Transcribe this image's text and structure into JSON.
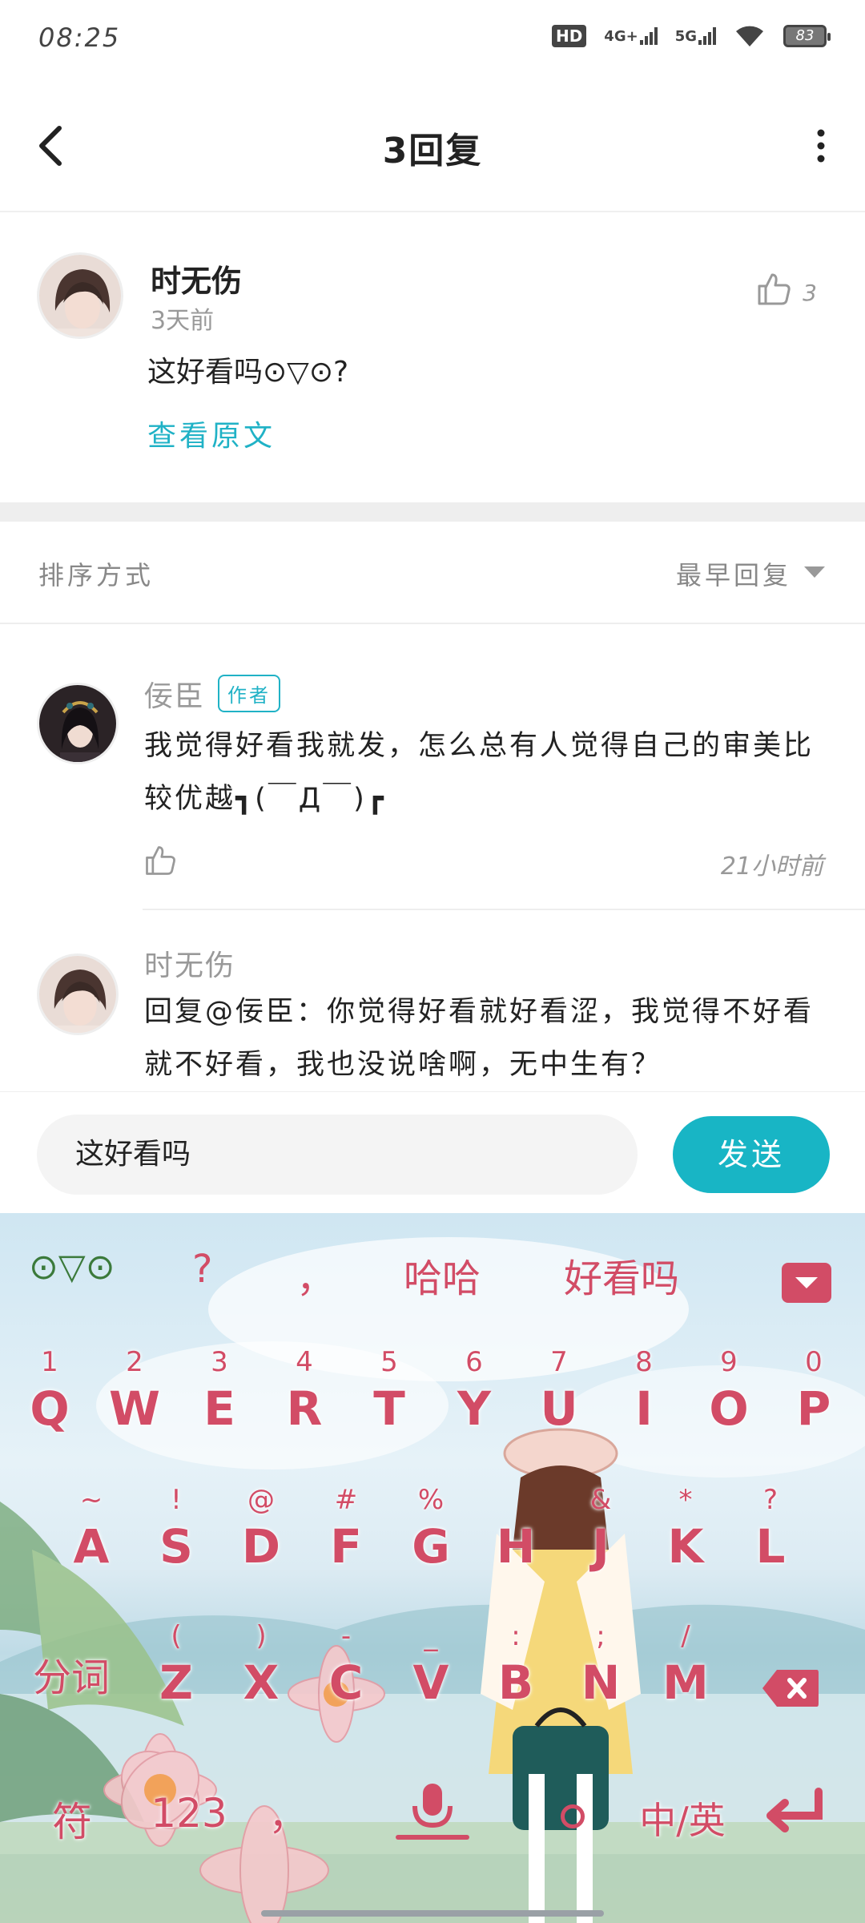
{
  "status_bar": {
    "time": "08:25",
    "hd_label": "HD",
    "network1": "4G+",
    "network2": "5G",
    "battery": "83"
  },
  "header": {
    "title": "3回复",
    "back_icon": "chevron-left-icon",
    "more_icon": "more-vertical-icon"
  },
  "post": {
    "author": "时无伤",
    "time": "3天前",
    "content": "这好看吗⊙▽⊙?",
    "view_original": "查看原文",
    "like_count": "3"
  },
  "sort": {
    "label": "排序方式",
    "value": "最早回复"
  },
  "replies": [
    {
      "author": "佞臣",
      "badge": "作者",
      "content": "我觉得好看我就发，怎么总有人觉得自己的审美比较优越┓(￣Д￣)┏",
      "time": "21小时前"
    },
    {
      "author": "时无伤",
      "content": "回复@佞臣：你觉得好看就好看涩，我觉得不好看就不好看，我也没说啥啊，无中生有？"
    }
  ],
  "input": {
    "value": "这好看吗",
    "send_label": "发送"
  },
  "keyboard": {
    "candidates": [
      "⊙▽⊙",
      "?",
      "，",
      "哈哈",
      "好看吗"
    ],
    "numbers": [
      "1",
      "2",
      "3",
      "4",
      "5",
      "6",
      "7",
      "8",
      "9",
      "0"
    ],
    "row1": [
      "Q",
      "W",
      "E",
      "R",
      "T",
      "Y",
      "U",
      "I",
      "O",
      "P"
    ],
    "row2_sub": [
      "~",
      "!",
      "@",
      "#",
      "%",
      "",
      "&",
      "*",
      "?"
    ],
    "row2": [
      "A",
      "S",
      "D",
      "F",
      "G",
      "H",
      "J",
      "K",
      "L"
    ],
    "row3_sub": [
      "(",
      ")",
      "-",
      "_",
      ":",
      ";",
      "/"
    ],
    "row3": [
      "Z",
      "X",
      "C",
      "V",
      "B",
      "N",
      "M"
    ],
    "split_label": "分词",
    "symbol_label": "符",
    "num_label": "123",
    "comma_label": "，",
    "lang_label": "中/英",
    "colors": {
      "key_text": "#d24c66",
      "accent": "#18b5c5"
    }
  }
}
